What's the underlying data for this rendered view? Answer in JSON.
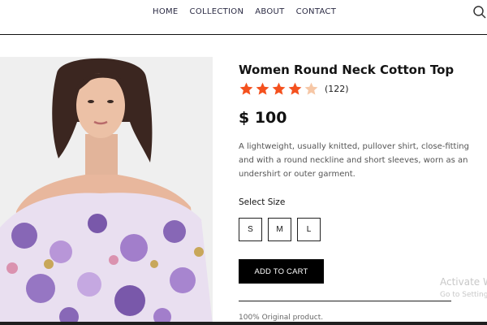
{
  "nav": {
    "items": [
      "HOME",
      "COLLECTION",
      "ABOUT",
      "CONTACT"
    ],
    "search_icon": "search-icon"
  },
  "product": {
    "title": "Women Round Neck Cotton Top",
    "rating": 4.5,
    "rating_max": 5,
    "review_count": "(122)",
    "price": "$ 100",
    "description": "A lightweight, usually knitted, pullover shirt, close-fitting and with a round neckline and short sleeves, worn as an undershirt or outer garment.",
    "size_label": "Select Size",
    "sizes": [
      "S",
      "M",
      "L"
    ],
    "add_to_cart": "ADD TO CART",
    "original_note": "100% Original product."
  },
  "watermark": {
    "title": "Activate W",
    "subtitle": "Go to Setting"
  },
  "colors": {
    "star": "#f4511e",
    "star_half": "#f6c7a6",
    "button": "#000000",
    "nav_text": "#2b2b44"
  }
}
